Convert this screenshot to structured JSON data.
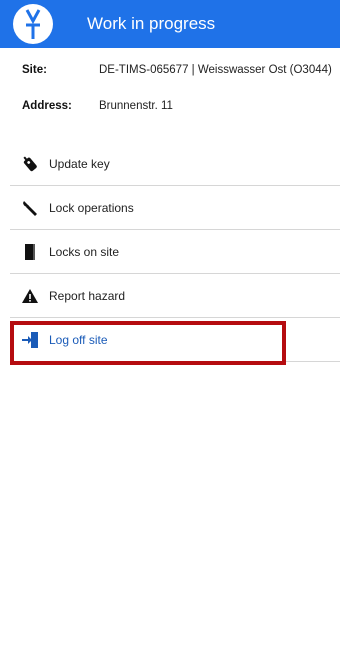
{
  "header": {
    "logo_icon": "vt-logo-icon",
    "title": "Work in progress",
    "color": "#1f72e8"
  },
  "info": {
    "site_label": "Site:",
    "site_value": "DE-TIMS-065677 | Weisswasser Ost (O3044)",
    "address_label": "Address:",
    "address_value": "Brunnenstr. 11"
  },
  "menu": {
    "items": [
      {
        "label": "Update key",
        "icon": "key-fob-icon"
      },
      {
        "label": "Lock operations",
        "icon": "wrench-icon"
      },
      {
        "label": "Locks on site",
        "icon": "door-icon"
      },
      {
        "label": "Report hazard",
        "icon": "warning-icon"
      },
      {
        "label": "Log off site",
        "icon": "log-off-icon"
      }
    ],
    "active_color": "#1a5bb8"
  },
  "highlight_color": "#b50c10"
}
